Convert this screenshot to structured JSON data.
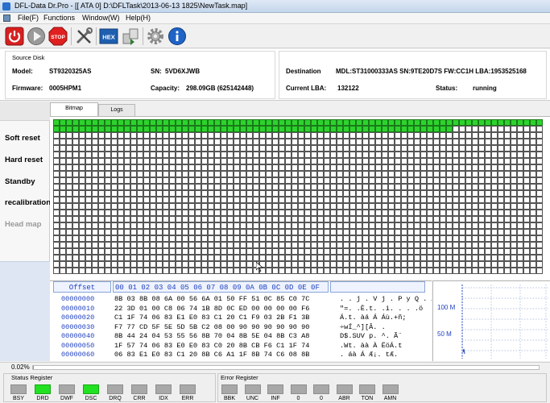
{
  "window": {
    "title": "DFL-Data Dr.Pro - [[ ATA 0]  D:\\DFLTask\\2013-06-13 1825\\NewTask.map]"
  },
  "menu": [
    "File(F)",
    "Functions",
    "Window(W)",
    "Help(H)"
  ],
  "toolbar": {
    "icons": [
      "power-icon",
      "play-icon",
      "stop-icon",
      "tools-icon",
      "hex-icon",
      "copy-icon",
      "gear-icon",
      "info-icon"
    ],
    "stop_label": "STOP",
    "hex_label": "HEX"
  },
  "source": {
    "group_label": "Source Disk",
    "model_label": "Model:",
    "model": "ST9320325AS",
    "sn_label": "SN:",
    "sn": "5VD6XJWB",
    "firmware_label": "Firmware:",
    "firmware": "0005HPM1",
    "capacity_label": "Capacity:",
    "capacity": "298.09GB (625142448)"
  },
  "destination": {
    "label": "Destination",
    "info": "MDL:ST31000333AS  SN:9TE20D7S  FW:CC1H  LBA:1953525168",
    "lba_label": "Current LBA:",
    "lba": "132122",
    "status_label": "Status:",
    "status": "running"
  },
  "sidebar": [
    "Soft reset",
    "Hard reset",
    "Standby",
    "recalibration",
    "Head map"
  ],
  "tabs": [
    "Bitmap",
    "Logs"
  ],
  "bitmap": {
    "done_cells": 62
  },
  "hex": {
    "offset_header": "Offset",
    "columns_header": "00 01 02 03 04 05 06 07 08 09 0A 0B 0C 0D 0E 0F",
    "rows": [
      {
        "off": "00000000",
        "bytes": "8B 03 8B 08 6A 00 56 6A 01 50 FF 51 0C 85 C0 7C",
        "ascii": "  . . j . V j . P y Q .  À|"
      },
      {
        "off": "00000010",
        "bytes": "22 3D 01 00 C8 06 74 1B 8D 0C ED 00 00 00 00 F6",
        "ascii": "\"=. .È.t.  .i. . . .ö"
      },
      {
        "off": "00000020",
        "bytes": "C1 1F 74 06 83 E1 E0 83 C1 20 C1 F9 03 2B F1 3B",
        "ascii": "Á.t. àá Á Áù.+ñ;"
      },
      {
        "off": "00000030",
        "bytes": "F7 77 CD 5F 5E 5D 5B C2 08 00 90 90 90 90 90 90",
        "ascii": "÷wÍ_^][Â. ."
      },
      {
        "off": "00000040",
        "bytes": "8B 44 24 04 53 55 56 8B 70 04 8B 5E 04 8B C3 A8",
        "ascii": " D$.SUV p. ^. Ã¨"
      },
      {
        "off": "00000050",
        "bytes": "1F 57 74 06 83 E0 E0 83 C0 20 8B CB F6 C1 1F 74",
        "ascii": ".Wt. àà À  ËöÁ.t"
      },
      {
        "off": "00000060",
        "bytes": "06 83 E1 E0 83 C1 20 8B C6 A1 1F 8B 74 C6 08 8B",
        "ascii": ". áà Á  Æ¡. tÆ. "
      }
    ]
  },
  "graph": {
    "labels": [
      "100 M",
      "50 M"
    ]
  },
  "progress": {
    "label": "0.02%",
    "fraction": 0.0002
  },
  "status_register": {
    "title": "Status Register",
    "leds": [
      {
        "name": "BSY",
        "on": false
      },
      {
        "name": "DRD",
        "on": true
      },
      {
        "name": "DWF",
        "on": false
      },
      {
        "name": "DSC",
        "on": true
      },
      {
        "name": "DRQ",
        "on": false
      },
      {
        "name": "CRR",
        "on": false
      },
      {
        "name": "IDX",
        "on": false
      },
      {
        "name": "ERR",
        "on": false
      }
    ]
  },
  "error_register": {
    "title": "Error Register",
    "leds": [
      {
        "name": "BBK",
        "on": false
      },
      {
        "name": "UNC",
        "on": false
      },
      {
        "name": "INF",
        "on": false
      },
      {
        "name": "0",
        "on": false
      },
      {
        "name": "0",
        "on": false
      },
      {
        "name": "ABR",
        "on": false
      },
      {
        "name": "TON",
        "on": false
      },
      {
        "name": "AMN",
        "on": false
      }
    ]
  },
  "colors": {
    "done": "#2ed32e",
    "led_on": "#22e022",
    "led_off": "#a8a8a8",
    "hex_blue": "#1f3fbf"
  }
}
